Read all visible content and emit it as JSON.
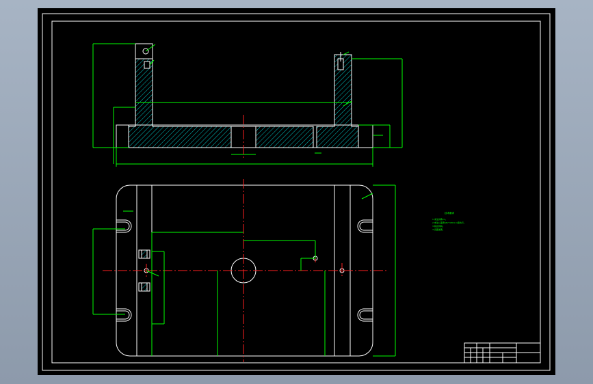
{
  "drawing": {
    "background": "#000000",
    "colors": {
      "outline": "#ffffff",
      "dimension": "#00ff00",
      "centerline": "#ff2020",
      "hatch": "#00c8c8",
      "border": "#ffffff"
    },
    "tech_notes_title": "技术要求",
    "tech_notes": [
      "1.未注倒角C1。",
      "2.未注公差按GB/T1804-m级执行。",
      "3.锐边倒钝。",
      "4.表面发黑。"
    ],
    "title_block": {
      "label": "title-block"
    }
  }
}
